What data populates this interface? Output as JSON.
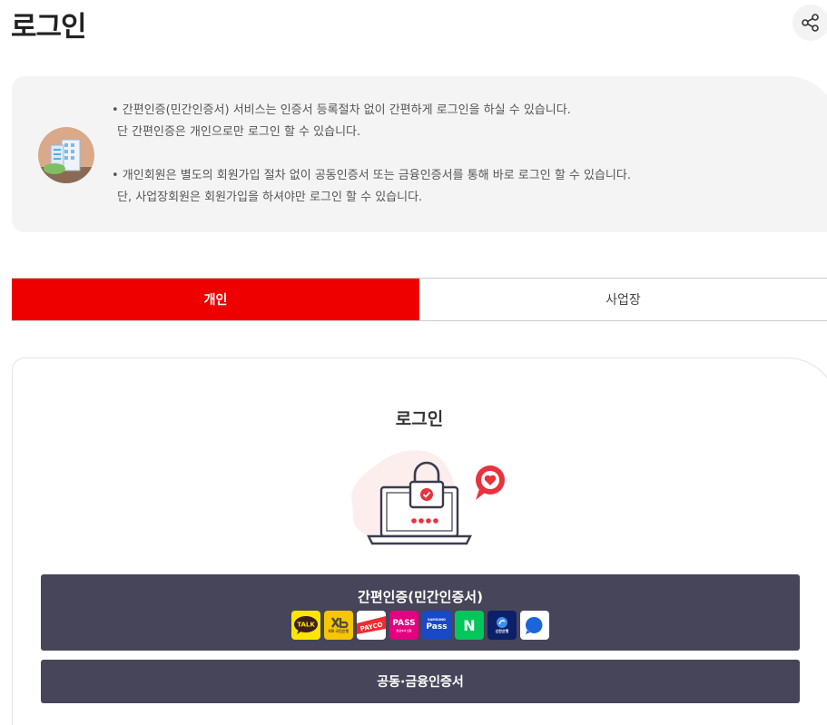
{
  "page": {
    "title": "로그인"
  },
  "header": {
    "share_icon": "share-icon"
  },
  "notice": {
    "avatar_icon": "building-icon",
    "lines": [
      "• 간편인증(민간인증서) 서비스는 인증서 등록절차 없이 간편하게 로그인을 하실 수 있습니다.",
      "단 간편인증은 개인으로만 로그인 할 수 있습니다.",
      "• 개인회원은 별도의 회원가입 절차 없이 공동인증서 또는 금융인증서를 통해 바로 로그인 할 수 있습니다.",
      "단, 사업장회원은 회원가입을 하셔야만 로그인 할 수 있습니다."
    ]
  },
  "tabs": [
    {
      "label": "개인",
      "active": true
    },
    {
      "label": "사업장",
      "active": false
    }
  ],
  "login": {
    "title": "로그인",
    "illustration_icon": "laptop-lock-icon",
    "easy_auth_label": "간편인증(민간인증서)",
    "cert_label": "공동·금융인증서",
    "providers": [
      {
        "name": "kakao-icon",
        "text": "TALK",
        "bg": "#fee500",
        "fg": "#3c1e1e"
      },
      {
        "name": "kb-icon",
        "text": "KB 국민은행",
        "bg": "#f7c600",
        "fg": "#554b3c"
      },
      {
        "name": "payco-icon",
        "text": "PAYCO",
        "bg": "#ffffff",
        "fg": "#ffffff"
      },
      {
        "name": "pass-icon",
        "text": "PASS",
        "sub": "통신3사 인증",
        "bg": "#e4007f",
        "fg": "#ffffff"
      },
      {
        "name": "samsung-pass-icon",
        "text": "Pass",
        "sub": "SAMSUNG",
        "bg": "#1a49c6",
        "fg": "#ffffff"
      },
      {
        "name": "naver-icon",
        "text": "N",
        "bg": "#03c75a",
        "fg": "#ffffff"
      },
      {
        "name": "shinhan-icon",
        "text": "신한은행",
        "bg": "#0b2069",
        "fg": "#ffffff"
      },
      {
        "name": "toss-icon",
        "text": "",
        "bg": "#ffffff",
        "fg": "#1b64da"
      }
    ]
  },
  "colors": {
    "accent": "#ee0000",
    "button_bg": "#464559",
    "notice_bg": "#f4f4f4"
  }
}
